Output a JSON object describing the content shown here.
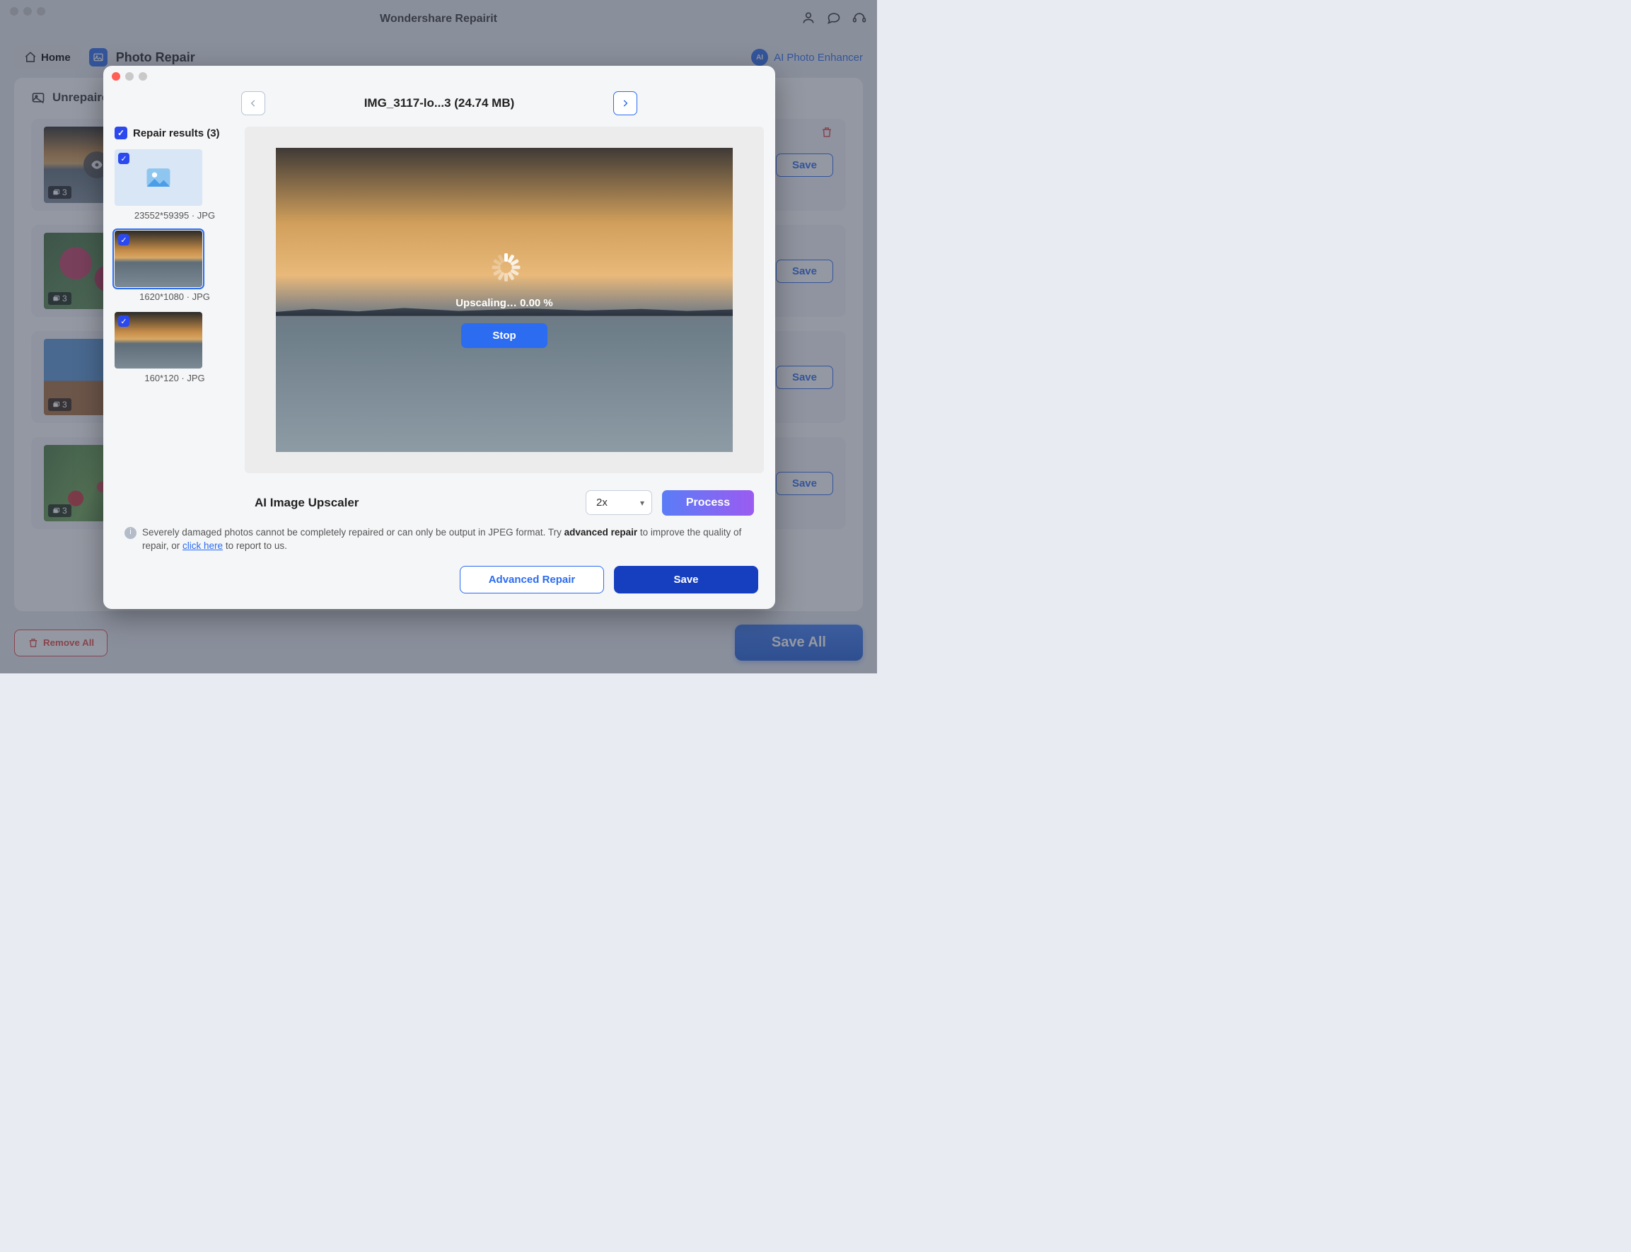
{
  "app": {
    "title": "Wondershare Repairit"
  },
  "toolbar": {
    "home": "Home",
    "section": "Photo Repair",
    "ai_enhancer": "AI Photo Enhancer"
  },
  "main": {
    "unrepaired_label": "Unrepaired",
    "rows": [
      {
        "badge": "3",
        "save": "Save"
      },
      {
        "badge": "3",
        "save": "Save"
      },
      {
        "badge": "3",
        "save": "Save"
      },
      {
        "badge": "3",
        "save": "Save"
      }
    ]
  },
  "bottom": {
    "remove_all": "Remove All",
    "save_all": "Save All"
  },
  "modal": {
    "title": "IMG_3117-lo...3 (24.74 MB)",
    "repair_results_label": "Repair results (3)",
    "results": [
      {
        "meta": "23552*59395 · JPG"
      },
      {
        "meta": "1620*1080 · JPG"
      },
      {
        "meta": "160*120 · JPG"
      }
    ],
    "upscaling_text": "Upscaling… 0.00 %",
    "stop": "Stop",
    "upscaler_title": "AI Image Upscaler",
    "scale_value": "2x",
    "process": "Process",
    "notice_a": "Severely damaged photos cannot be completely repaired or can only be output in JPEG format. Try ",
    "notice_bold": "advanced repair",
    "notice_b": " to improve the quality of repair, or ",
    "notice_link": "click here",
    "notice_c": " to report to us.",
    "advanced_repair": "Advanced Repair",
    "save": "Save"
  }
}
